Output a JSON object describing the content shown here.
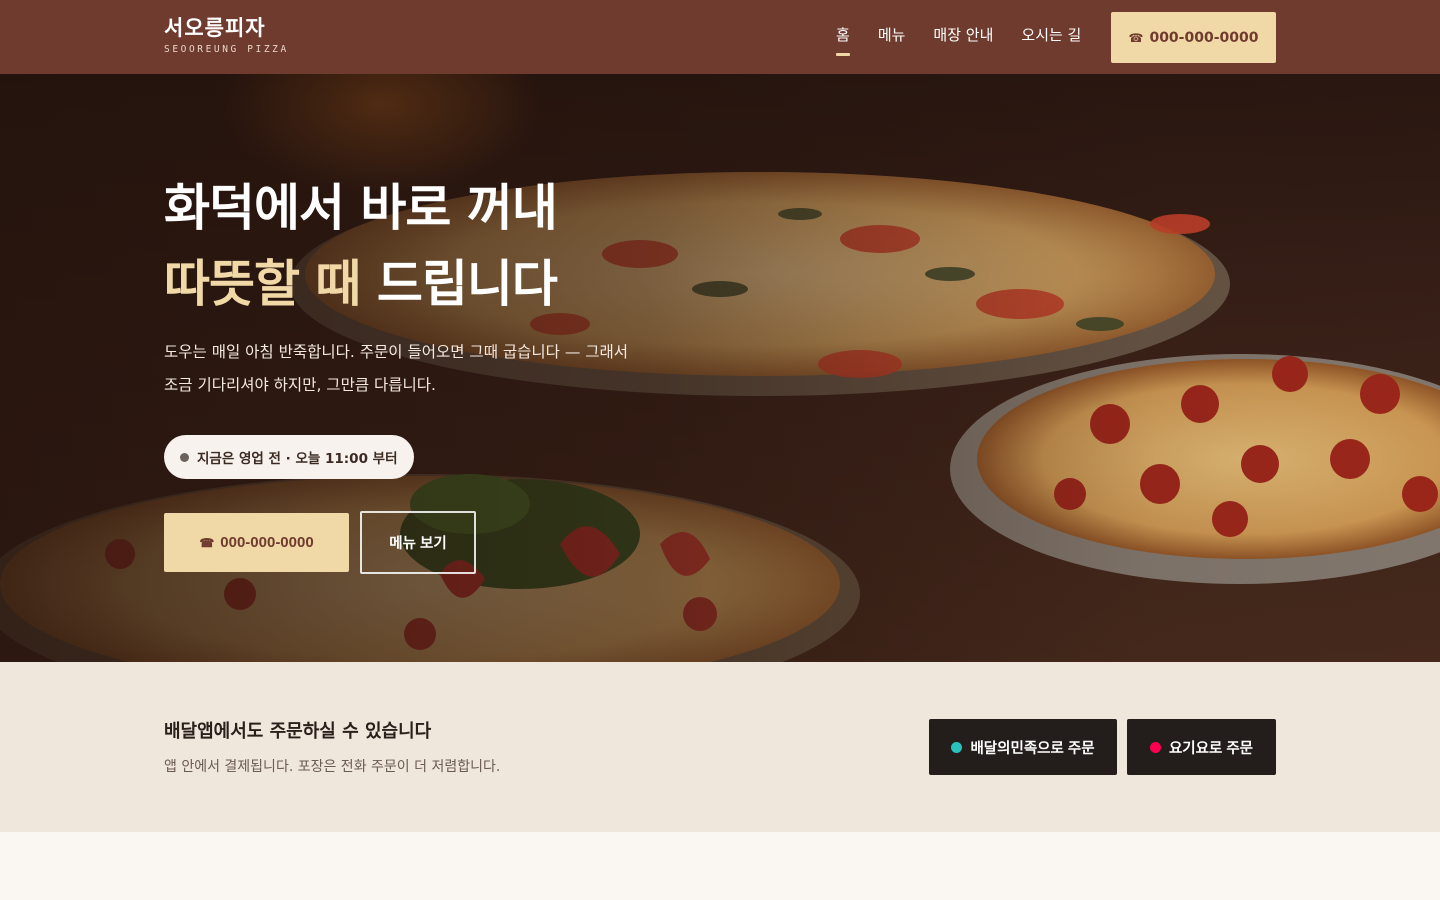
{
  "header": {
    "brand_name": "서오릉피자",
    "brand_sub": "SEOOREUNG PIZZA",
    "nav": [
      {
        "label": "홈",
        "active": true
      },
      {
        "label": "메뉴",
        "active": false
      },
      {
        "label": "매장 안내",
        "active": false
      },
      {
        "label": "오시는 길",
        "active": false
      }
    ],
    "call_label": "000-000-0000",
    "call_icon": "phone-icon",
    "colors": {
      "bar": "#6f3b2e",
      "accent": "#f1d9a7"
    }
  },
  "hero": {
    "title_line1": "화덕에서 바로 꺼내",
    "title_line2_accent": "따뜻할 때",
    "title_line2_rest": " 드립니다",
    "description_line1": "도우는 매일 아침 반죽합니다. 주문이 들어오면 그때 굽습니다 — 그래서",
    "description_line2": "조금 기다리셔야 하지만, 그만큼 다릅니다.",
    "status": "지금은 영업 전 · 오늘 11:00 부터",
    "call_label": "000-000-0000",
    "menu_label": "메뉴 보기"
  },
  "delivery": {
    "title": "배달앱에서도 주문하실 수 있습니다",
    "description": "앱 안에서 결제됩니다. 포장은 전화 주문이 더 저렴합니다.",
    "apps": [
      {
        "label": "배달의민족으로 주문",
        "dot_color": "#2ac1bc"
      },
      {
        "label": "요기요로 주문",
        "dot_color": "#fa0050"
      }
    ]
  }
}
